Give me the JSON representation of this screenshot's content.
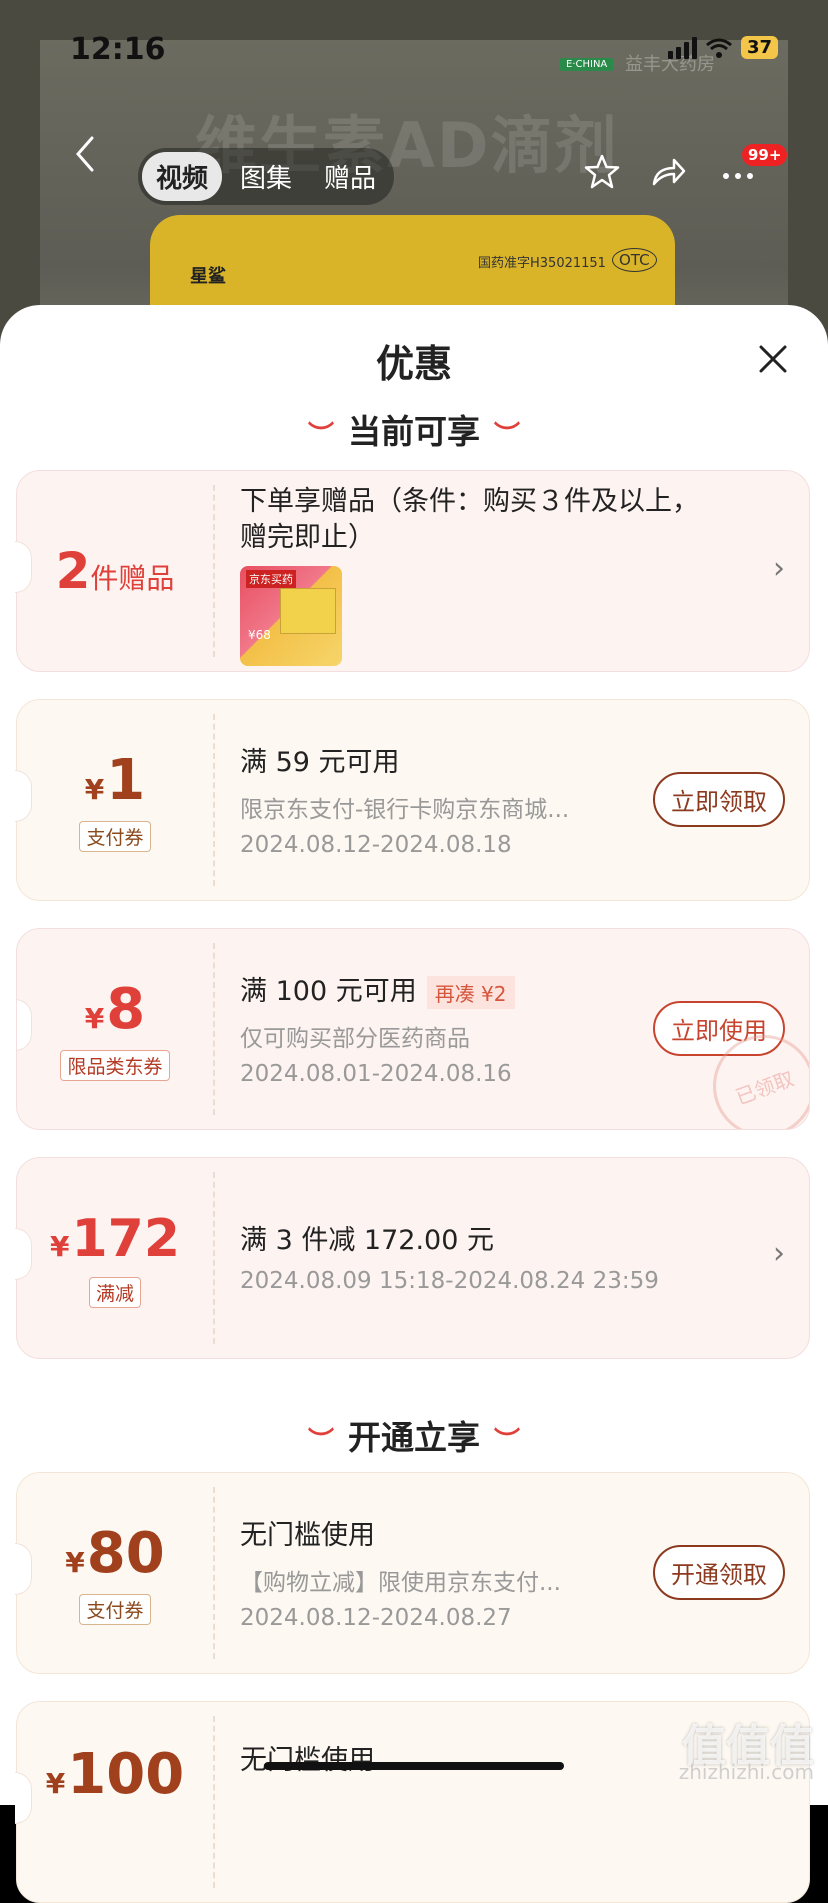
{
  "status_bar": {
    "time": "12:16",
    "battery": "37"
  },
  "background": {
    "title": "维生素AD滴剂",
    "brand": "星鲨",
    "registration": "国药准字H35021151",
    "otc": "OTC",
    "echina": "E·CHINA",
    "pharmacy_logo": "益丰大药房"
  },
  "nav": {
    "tabs": [
      "视频",
      "图集",
      "赠品"
    ],
    "active_tab": 0,
    "badge": "99+"
  },
  "sheet": {
    "title": "优惠",
    "section_current": "当前可享",
    "section_open": "开通立享"
  },
  "cards": [
    {
      "amount_num": "2",
      "amount_unit": "件赠品",
      "main": "下单享赠品（条件：购买３件及以上，",
      "main2": "赠完即止）",
      "gift_label": "京东买药",
      "gift_price": "¥68"
    },
    {
      "currency": "¥",
      "amount": "1",
      "tag": "支付券",
      "main": "满 59 元可用",
      "desc": "限京东支付-银行卡购京东商城...",
      "date": "2024.08.12-2024.08.18",
      "action": "立即领取"
    },
    {
      "currency": "¥",
      "amount": "8",
      "tag": "限品类东券",
      "main": "满 100 元可用",
      "mini_tag": "再凑 ¥2",
      "desc": "仅可购买部分医药商品",
      "date": "2024.08.01-2024.08.16",
      "action": "立即使用",
      "stamp": "已领取"
    },
    {
      "currency": "¥",
      "amount": "172",
      "tag": "满减",
      "main": "满 3 件减 172.00 元",
      "date": "2024.08.09 15:18-2024.08.24 23:59"
    },
    {
      "currency": "¥",
      "amount": "80",
      "tag": "支付券",
      "main": "无门槛使用",
      "desc": "【购物立减】限使用京东支付...",
      "date": "2024.08.12-2024.08.27",
      "action": "开通领取"
    },
    {
      "currency": "¥",
      "amount": "100",
      "main": "无门槛使用"
    }
  ],
  "watermark": {
    "main": "值值值",
    "sub": "zhizhizhi.com"
  }
}
